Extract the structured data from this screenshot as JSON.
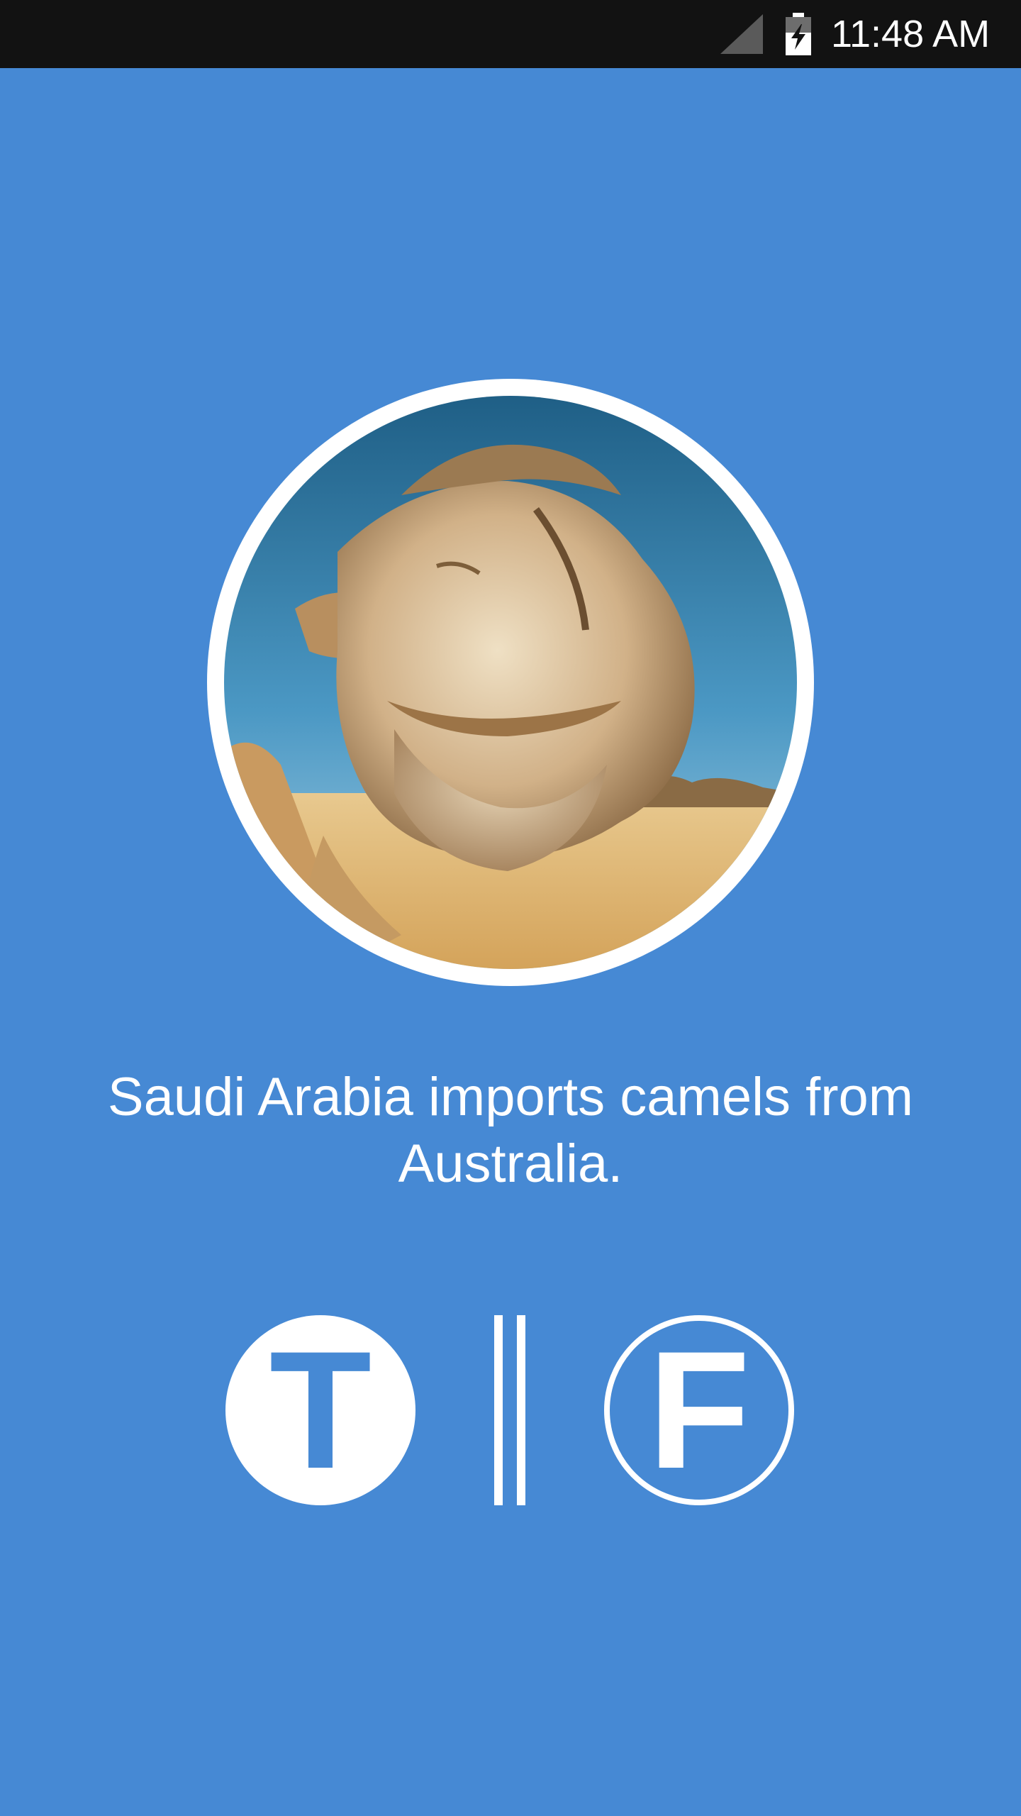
{
  "status_bar": {
    "time": "11:48 AM",
    "signal_icon": "cell-signal-icon",
    "battery_icon": "battery-charging-icon"
  },
  "photo": {
    "icon": "camel-photo"
  },
  "fact": {
    "text": "Saudi Arabia imports camels from Australia."
  },
  "answers": {
    "true_label": "T",
    "false_label": "F"
  },
  "colors": {
    "background": "#4689d4",
    "status_bar": "#121212",
    "foreground": "#ffffff"
  }
}
